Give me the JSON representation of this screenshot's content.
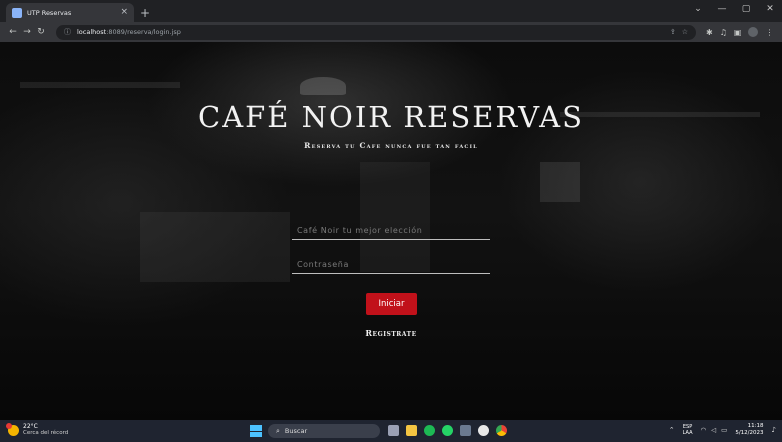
{
  "browser": {
    "tab_title": "UTP Reservas",
    "tab_close": "×",
    "new_tab": "+",
    "url_host": "localhost",
    "url_path": ":8089/reserva/login.jsp",
    "window_controls": [
      "⌄",
      "—",
      "▢",
      "✕"
    ]
  },
  "page": {
    "title": "CAFÉ NOIR RESERVAS",
    "subtitle": "Reserva tu Cafe nunca fue tan facil",
    "username_placeholder": "Café Noir tu mejor elección",
    "password_placeholder": "Contraseña",
    "login_button": "Iniciar",
    "register_link": "Registrate",
    "accent_color": "#c1111a"
  },
  "taskbar": {
    "weather_temp": "22°C",
    "weather_condition": "Cerca del récord",
    "search_label": "Buscar",
    "language_primary": "ESP",
    "language_secondary": "LAA",
    "time": "11:18",
    "date": "5/12/2023"
  }
}
